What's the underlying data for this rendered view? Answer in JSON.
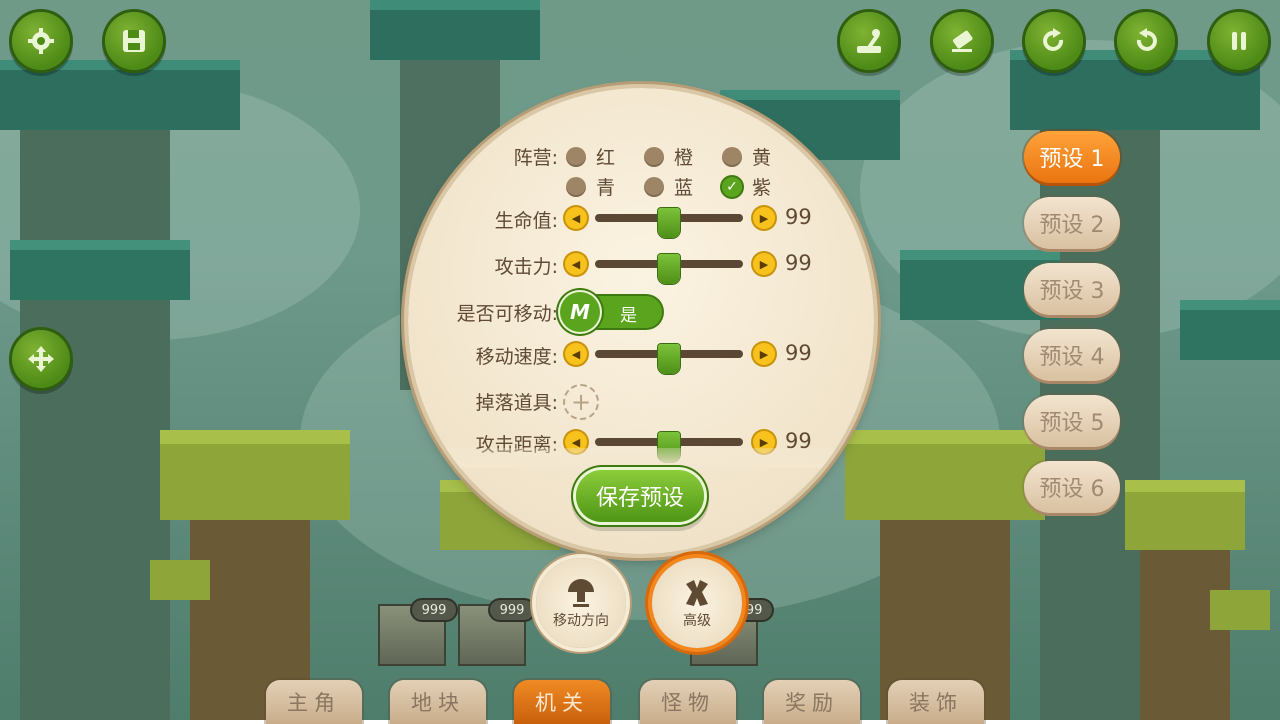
{
  "toolbar": {
    "left": [
      {
        "icon": "settings-gear-icon"
      },
      {
        "icon": "save-floppy-icon"
      }
    ],
    "right": [
      {
        "icon": "lever-icon"
      },
      {
        "icon": "eraser-icon"
      },
      {
        "icon": "redo-icon"
      },
      {
        "icon": "undo-icon"
      },
      {
        "icon": "pause-icon"
      }
    ],
    "move": {
      "icon": "move-arrows-icon"
    }
  },
  "presets": [
    "预设 1",
    "预设 2",
    "预设 3",
    "预设 4",
    "预设 5",
    "预设 6"
  ],
  "active_preset_index": 0,
  "panel": {
    "faction": {
      "label": "阵营:",
      "options": [
        "红",
        "橙",
        "黄",
        "青",
        "蓝",
        "紫"
      ],
      "selected": "紫"
    },
    "hp": {
      "label": "生命值:",
      "value": "99",
      "fraction": 0.5
    },
    "attack": {
      "label": "攻击力:",
      "value": "99",
      "fraction": 0.5
    },
    "movable": {
      "label": "是否可移动:",
      "knob": "M",
      "state": "是"
    },
    "move_speed": {
      "label": "移动速度:",
      "value": "99",
      "fraction": 0.5
    },
    "drop_item": {
      "label": "掉落道具:"
    },
    "attack_range": {
      "label": "攻击距离:",
      "value": "99",
      "fraction": 0.5
    },
    "save_label": "保存预设"
  },
  "modes": [
    {
      "label": "移动方向",
      "icon": "mushroom-direction-icon",
      "active": false
    },
    {
      "label": "高级",
      "icon": "advanced-arms-icon",
      "active": true
    }
  ],
  "tabs": [
    "主角",
    "地块",
    "机关",
    "怪物",
    "奖励",
    "装饰"
  ],
  "active_tab_index": 2,
  "inventory": [
    {
      "count": "999"
    },
    {
      "count": "999"
    },
    {
      "count": "999"
    }
  ],
  "colors": {
    "accent_green": "#5aa51d",
    "accent_orange": "#ef7f1a",
    "panel_bg": "#f6ecd8"
  }
}
